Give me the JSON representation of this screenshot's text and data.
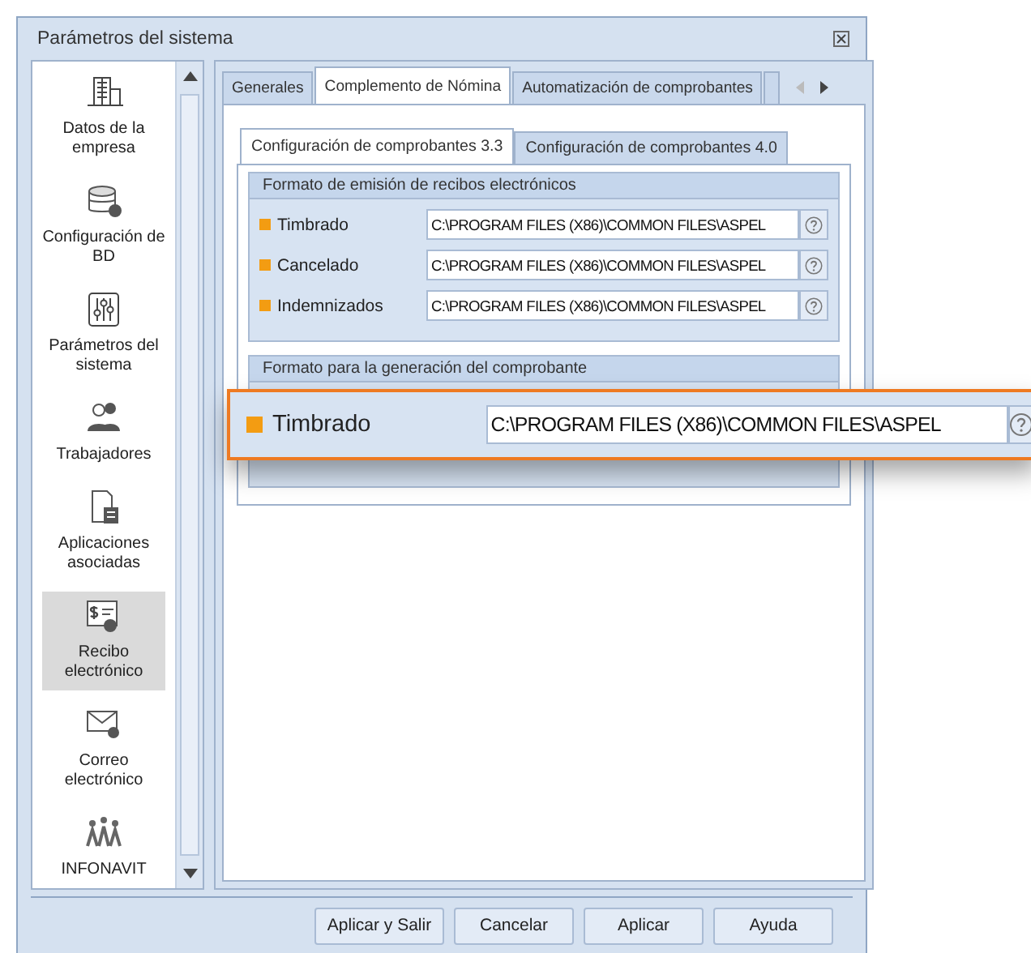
{
  "window": {
    "title": "Parámetros del sistema"
  },
  "sidebar": {
    "items": [
      {
        "label": "Datos de la empresa",
        "selected": false
      },
      {
        "label": "Configuración de BD",
        "selected": false
      },
      {
        "label": "Parámetros del sistema",
        "selected": false
      },
      {
        "label": "Trabajadores",
        "selected": false
      },
      {
        "label": "Aplicaciones asociadas",
        "selected": false
      },
      {
        "label": "Recibo electrónico",
        "selected": true
      },
      {
        "label": "Correo electrónico",
        "selected": false
      },
      {
        "label": "INFONAVIT",
        "selected": false
      }
    ]
  },
  "tabs": [
    {
      "label": "Generales",
      "selected": false
    },
    {
      "label": "Complemento de Nómina",
      "selected": true
    },
    {
      "label": "Automatización de comprobantes",
      "selected": false
    }
  ],
  "subtabs": [
    {
      "label": "Configuración de comprobantes 3.3",
      "selected": true
    },
    {
      "label": "Configuración de comprobantes 4.0",
      "selected": false
    }
  ],
  "groups": [
    {
      "title": "Formato de emisión de recibos electrónicos",
      "rows": [
        {
          "label": "Timbrado",
          "value": "C:\\PROGRAM FILES (X86)\\COMMON FILES\\ASPEL"
        },
        {
          "label": "Cancelado",
          "value": "C:\\PROGRAM FILES (X86)\\COMMON FILES\\ASPEL"
        },
        {
          "label": "Indemnizados",
          "value": "C:\\PROGRAM FILES (X86)\\COMMON FILES\\ASPEL"
        }
      ]
    },
    {
      "title": "Formato para la generación del comprobante"
    }
  ],
  "callout": {
    "label": "Timbrado",
    "value": "C:\\PROGRAM FILES (X86)\\COMMON FILES\\ASPEL"
  },
  "buttons": [
    "Aplicar y Salir",
    "Cancelar",
    "Aplicar",
    "Ayuda"
  ]
}
